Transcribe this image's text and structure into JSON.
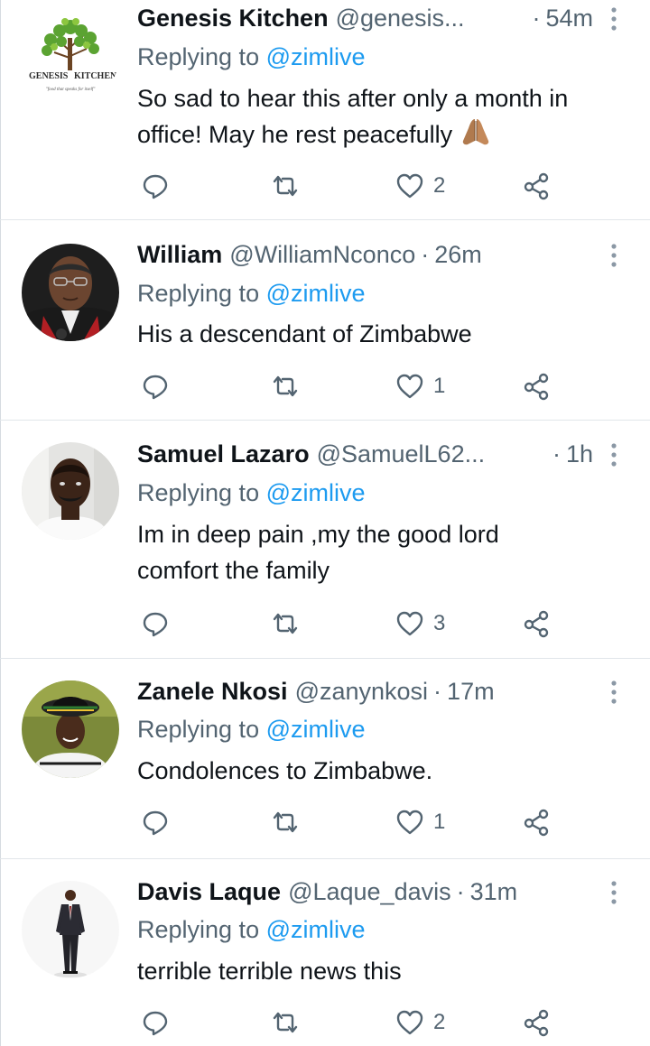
{
  "replying_label": "Replying to",
  "tweets": [
    {
      "name": "Genesis Kitchen",
      "handle": "@genesis...",
      "dot": "·",
      "time": "54m",
      "mention": "@zimlive",
      "text": "So sad to hear this after only a month in office! May he rest peacefully",
      "emoji": "folded-hands-emoji",
      "likes": "2",
      "avatar_logo_left": "GENESIS",
      "avatar_logo_right": "KITCHEN",
      "avatar_tagline": "\"food that speaks for itself\""
    },
    {
      "name": "William",
      "handle": "@WilliamNconco",
      "dot": "·",
      "time": "26m",
      "mention": "@zimlive",
      "text": "His a descendant of Zimbabwe",
      "likes": "1"
    },
    {
      "name": "Samuel Lazaro",
      "handle": "@SamuelL62...",
      "dot": "·",
      "time": "1h",
      "mention": "@zimlive",
      "text": "Im in deep pain ,my the good lord comfort the family",
      "likes": "3"
    },
    {
      "name": "Zanele Nkosi",
      "handle": "@zanynkosi",
      "dot": "·",
      "time": "17m",
      "mention": "@zimlive",
      "text": "Condolences to Zimbabwe.",
      "likes": "1"
    },
    {
      "name": "Davis Laque",
      "handle": "@Laque_davis",
      "dot": "·",
      "time": "31m",
      "mention": "@zimlive",
      "text": "terrible terrible news this",
      "likes": "2"
    }
  ],
  "icons": {
    "reply": "reply-icon",
    "retweet": "retweet-icon",
    "like": "heart-icon",
    "share": "share-icon",
    "more": "more-vertical-icon"
  },
  "colors": {
    "text": "#0f1419",
    "secondary": "#536471",
    "mention": "#1d9bf0",
    "divider": "#e1e6ea"
  }
}
